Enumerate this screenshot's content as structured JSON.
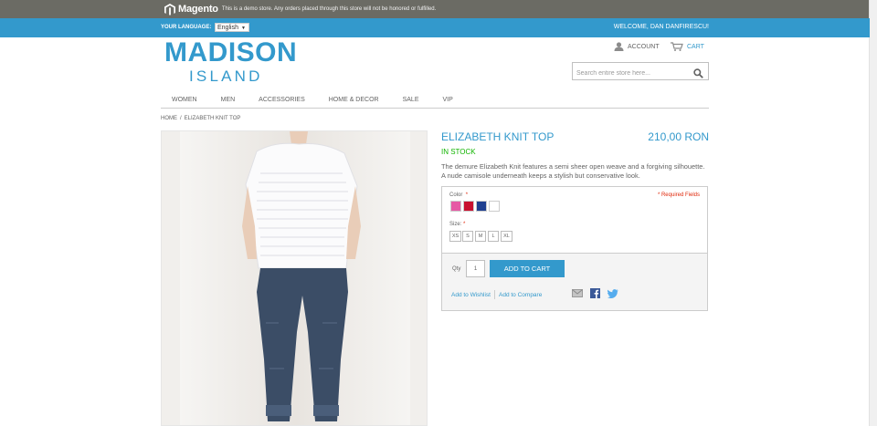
{
  "demo_bar": {
    "logo_text": "Magento",
    "notice": "This is a demo store. Any orders placed through this store will not be honored or fulfilled."
  },
  "header": {
    "language_label": "YOUR LANGUAGE:",
    "language_value": "English",
    "welcome": "WELCOME, DAN DANFIRESCU!"
  },
  "brand": {
    "line1": "MADISON",
    "line2": "ISLAND"
  },
  "account_label": "ACCOUNT",
  "cart_label": "CART",
  "search": {
    "placeholder": "Search entire store here..."
  },
  "nav": [
    "WOMEN",
    "MEN",
    "ACCESSORIES",
    "HOME & DECOR",
    "SALE",
    "VIP"
  ],
  "breadcrumb": {
    "home": "HOME",
    "separator": "/",
    "current": "ELIZABETH KNIT TOP"
  },
  "product": {
    "name": "ELIZABETH KNIT TOP",
    "price": "210,00 RON",
    "stock": "IN STOCK",
    "description": "The demure Elizabeth Knit features a semi sheer open weave and a forgiving silhouette. A nude camisole underneath keeps a stylish but conservative look.",
    "color_label": "Color",
    "required_star": "*",
    "required_note": "* Required Fields",
    "colors": [
      "#e65aa5",
      "#c8102e",
      "#1f3f8f",
      "#ffffff"
    ],
    "size_label": "Size:",
    "sizes": [
      "XS",
      "S",
      "M",
      "L",
      "XL"
    ],
    "qty_label": "Qty",
    "qty_value": "1",
    "add_to_cart": "ADD TO CART",
    "wishlist": "Add to Wishlist",
    "compare": "Add to Compare"
  }
}
